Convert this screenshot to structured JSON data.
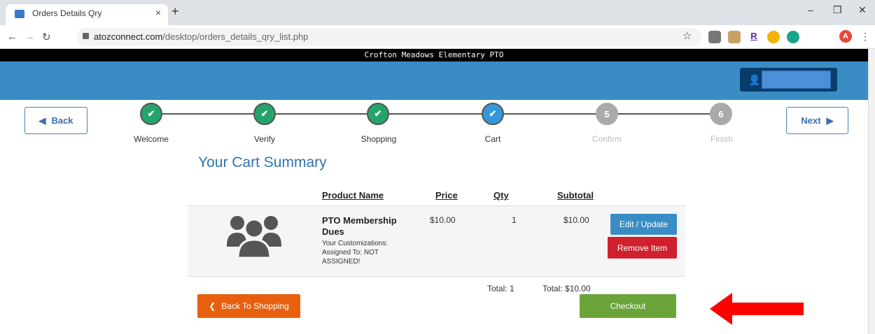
{
  "browser": {
    "tab_title": "Orders Details Qry",
    "tab_close": "×",
    "new_tab": "+",
    "url_domain": "atozconnect.com",
    "url_path": "/desktop/orders_details_qry_list.php",
    "profile_initial": "A",
    "minimize": "–",
    "restore": "❐",
    "close": "✕"
  },
  "site": {
    "org_name": "Crofton Meadows Elementary PTO",
    "username": ""
  },
  "wizard": {
    "back_label": "Back",
    "next_label": "Next",
    "steps": [
      {
        "label": "Welcome",
        "status": "done",
        "marker": "✔"
      },
      {
        "label": "Verify",
        "status": "done",
        "marker": "✔"
      },
      {
        "label": "Shopping",
        "status": "done",
        "marker": "✔"
      },
      {
        "label": "Cart",
        "status": "current",
        "marker": "✔"
      },
      {
        "label": "Confirm",
        "status": "pending",
        "marker": "5"
      },
      {
        "label": "Finish",
        "status": "pending",
        "marker": "6"
      }
    ]
  },
  "cart": {
    "title": "Your Cart Summary",
    "headers": {
      "product": "Product Name",
      "price": "Price",
      "qty": "Qty",
      "subtotal": "Subtotal"
    },
    "items": [
      {
        "name": "PTO Membership Dues",
        "customizations": "Your Customizations: Assigned To: NOT ASSIGNED!",
        "price": "$10.00",
        "qty": "1",
        "subtotal": "$10.00",
        "edit_label": "Edit / Update",
        "remove_label": "Remove Item"
      }
    ],
    "total_qty": "Total: 1",
    "total_amount": "Total: $10.00",
    "back_to_shopping_label": "Back To Shopping",
    "checkout_label": "Checkout"
  },
  "colors": {
    "banner": "#3a8dc4",
    "step_done": "#23a46a",
    "step_current": "#3498db",
    "edit_button": "#3a8dc4",
    "remove_button": "#d0202e",
    "back_button": "#e8600e",
    "checkout_button": "#6aa43a",
    "annotation_arrow": "#ff0000"
  }
}
